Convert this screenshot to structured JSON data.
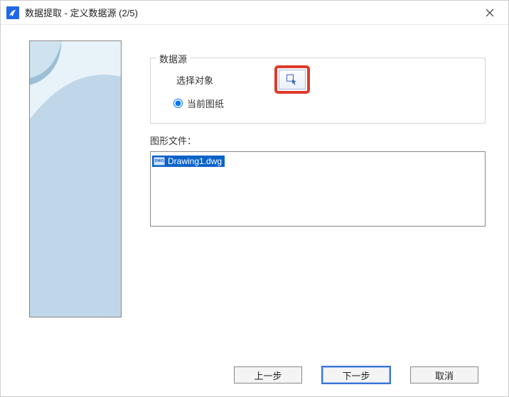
{
  "titlebar": {
    "title": "数据提取 - 定义数据源 (2/5)"
  },
  "source": {
    "group_title": "数据源",
    "select_objects_label": "选择对象",
    "current_drawing_label": "当前图纸"
  },
  "files": {
    "label": "图形文件：",
    "item": "Drawing1.dwg"
  },
  "footer": {
    "back": "上一步",
    "next": "下一步",
    "cancel": "取消"
  }
}
